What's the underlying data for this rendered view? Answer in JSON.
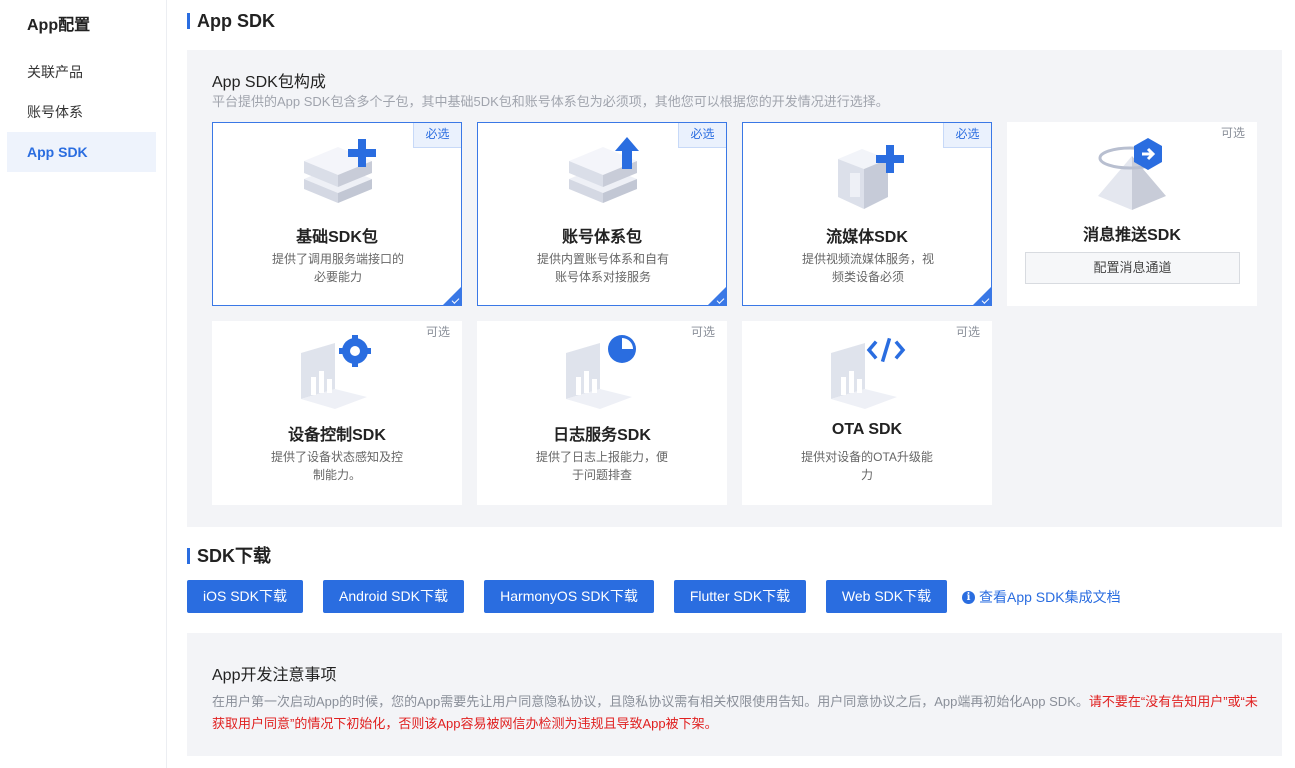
{
  "sidebar": {
    "title": "App配置",
    "items": [
      {
        "label": "关联产品",
        "active": false
      },
      {
        "label": "账号体系",
        "active": false
      },
      {
        "label": "App SDK",
        "active": true
      }
    ]
  },
  "sdk_section": {
    "title": "App SDK",
    "panel_title": "App SDK包构成",
    "panel_desc": "平台提供的App SDK包含多个子包，其中基础5DK包和账号体系包为必须项，其他您可以根据您的开发情况进行选择。",
    "required_tag": "必选",
    "optional_tag": "可选",
    "cards": [
      {
        "name": "基础SDK包",
        "desc": "提供了调用服务端接口的必要能力",
        "tag": "必选",
        "icon": "server-plus-icon"
      },
      {
        "name": "账号体系包",
        "desc": "提供内置账号体系和自有账号体系对接服务",
        "tag": "必选",
        "icon": "server-upload-icon"
      },
      {
        "name": "流媒体SDK",
        "desc": "提供视频流媒体服务，视频类设备必须",
        "tag": "必选",
        "icon": "media-box-plus-icon"
      },
      {
        "name": "消息推送SDK",
        "button": "配置消息通道",
        "tag": "可选",
        "icon": "push-message-icon"
      },
      {
        "name": "设备控制SDK",
        "desc": "提供了设备状态感知及控制能力。",
        "tag": "可选",
        "icon": "device-gear-icon"
      },
      {
        "name": "日志服务SDK",
        "desc": "提供了日志上报能力，便于问题排查",
        "tag": "可选",
        "icon": "log-chart-icon"
      },
      {
        "name": "OTA SDK",
        "desc": "提供对设备的OTA升级能力",
        "tag": "可选",
        "icon": "ota-code-icon"
      }
    ]
  },
  "download_section": {
    "title": "SDK下载",
    "buttons": [
      "iOS SDK下载",
      "Android SDK下载",
      "HarmonyOS SDK下载",
      "Flutter SDK下载",
      "Web SDK下载"
    ],
    "doc_link": "查看App SDK集成文档"
  },
  "notice": {
    "title": "App开发注意事项",
    "text": "在用户第一次启动App的时候，您的App需要先让用户同意隐私协议，且隐私协议需有相关权限使用告知。用户同意协议之后，App端再初始化App SDK。",
    "warning": "请不要在“没有告知用户”或“未获取用户同意”的情况下初始化，否则该App容易被网信办检测为违规且导致App被下架。"
  },
  "colors": {
    "accent": "#2a6de0",
    "warning": "#e02020",
    "panel_bg": "#f3f4f7"
  }
}
